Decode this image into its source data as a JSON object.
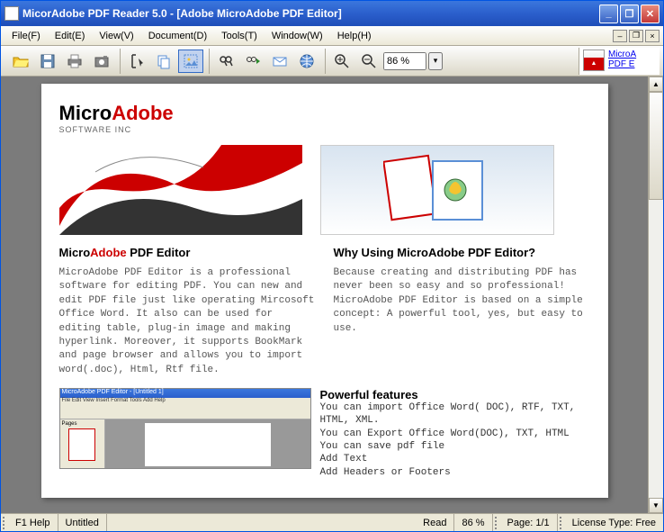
{
  "title": "MicorAdobe PDF Reader 5.0 - [Adobe MicroAdobe PDF Editor]",
  "menus": {
    "file": "File(F)",
    "edit": "Edit(E)",
    "view": "View(V)",
    "document": "Document(D)",
    "tools": "Tools(T)",
    "window": "Window(W)",
    "help": "Help(H)"
  },
  "zoom": {
    "value": "86 %"
  },
  "right_links": {
    "a": "MicroA",
    "b": "PDF E"
  },
  "page": {
    "brand_micro": "Micro",
    "brand_adobe": "Adobe",
    "brand_sub": "SOFTWARE INC",
    "left_heading_pre": "Micro",
    "left_heading_adobe": "Adobe",
    "left_heading_post": " PDF Editor",
    "left_body": "MicroAdobe PDF Editor is a professional software for editing PDF. You can new and edit PDF file just like operating Mircosoft Office Word. It also can be used for editing table, plug-in image and making hyperlink. Moreover, it supports BookMark and page browser and allows you to import word(.doc), Html, Rtf file.",
    "right_heading": "Why Using MicroAdobe PDF Editor?",
    "right_body": "Because creating and distributing PDF has never been so easy and so professional! MicroAdobe PDF Editor is based on a simple concept: A powerful tool, yes, but easy to use.",
    "features_heading": "Powerful features",
    "features_body": " You can import Office Word( DOC), RTF, TXT, HTML, XML.\n You can Export Office Word(DOC), TXT, HTML\n You can save pdf file\n Add Text\n Add Headers or Footers"
  },
  "status": {
    "help": "F1 Help",
    "doc": "Untitled",
    "mode": "Read",
    "zoom": "86 %",
    "page": "Page:  1/1",
    "license": "License Type:  Free"
  }
}
